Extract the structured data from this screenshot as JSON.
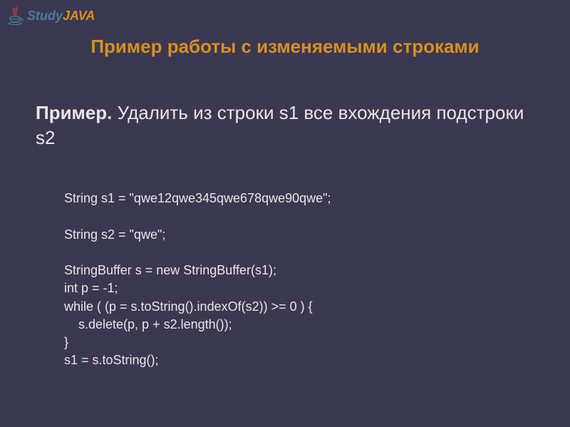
{
  "logo": {
    "study": "Study",
    "java": "JAVA"
  },
  "title": "Пример работы с изменяемыми строками",
  "description": {
    "bold": "Пример.",
    "text": " Удалить из строки s1 все вхождения подстроки s2"
  },
  "code": {
    "line1": "String s1 = \"qwe12qwe345qwe678qwe90qwe\";",
    "line2": "",
    "line3": "String s2 = \"qwe\";",
    "line4": "",
    "line5": "StringBuffer s = new StringBuffer(s1);",
    "line6": "int p = -1;",
    "line7": "while ( (p = s.toString().indexOf(s2)) >= 0 ) {",
    "line8": "    s.delete(p, p + s2.length());",
    "line9": "}",
    "line10": "s1 = s.toString();"
  }
}
